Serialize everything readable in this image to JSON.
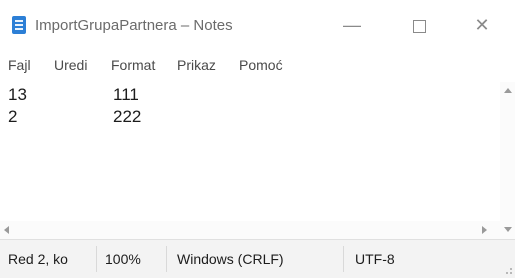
{
  "window": {
    "title": "ImportGrupaPartnera – Notes",
    "controls": {
      "minimize": "—",
      "close": "✕"
    }
  },
  "menu": [
    "Fajl",
    "Uredi",
    "Format",
    "Prikaz",
    "Pomoć"
  ],
  "editor": {
    "lines": [
      {
        "a": "13",
        "b": "111"
      },
      {
        "a": "2",
        "b": "222"
      }
    ]
  },
  "status": {
    "position": "Red 2, ko",
    "zoom": "100%",
    "line_ending": "Windows (CRLF)",
    "encoding": "UTF-8"
  },
  "colors": {
    "icon": "#2c7fd6",
    "statusbar": "#f3f3f3"
  }
}
